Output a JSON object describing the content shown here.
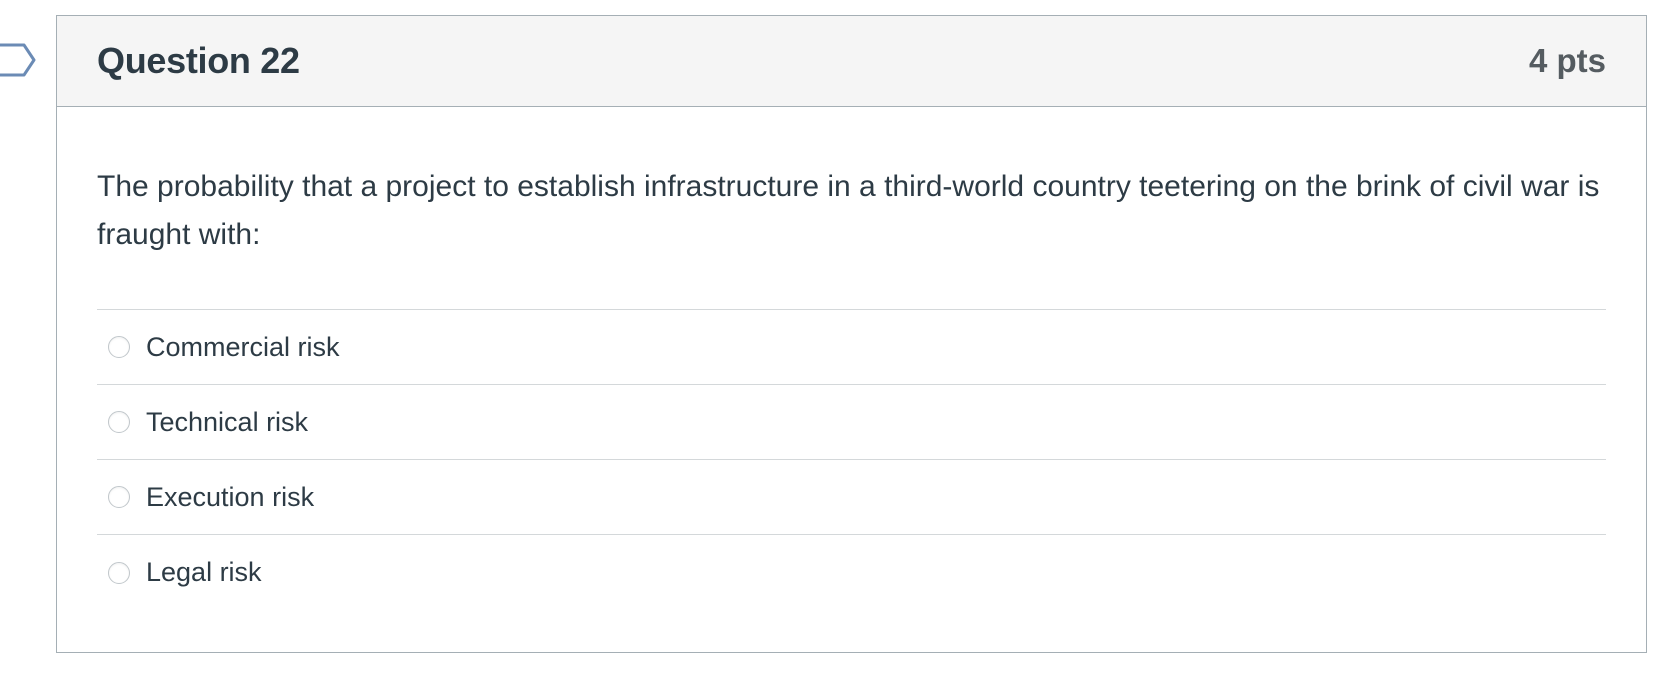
{
  "question": {
    "title": "Question 22",
    "points": "4 pts",
    "text": "The probability that a project to establish infrastructure in a third-world country teetering on the brink of civil war is fraught with:",
    "answers": [
      {
        "label": "Commercial risk",
        "selected": false
      },
      {
        "label": "Technical risk",
        "selected": false
      },
      {
        "label": "Execution risk",
        "selected": false
      },
      {
        "label": "Legal risk",
        "selected": false
      }
    ]
  },
  "colors": {
    "header_bg": "#f5f5f5",
    "border": "#a5afb5",
    "text": "#2d3b45",
    "points_text": "#555c61",
    "flag_outline": "#6b8bb5"
  },
  "icons": {
    "flag": "flag-question-icon"
  }
}
